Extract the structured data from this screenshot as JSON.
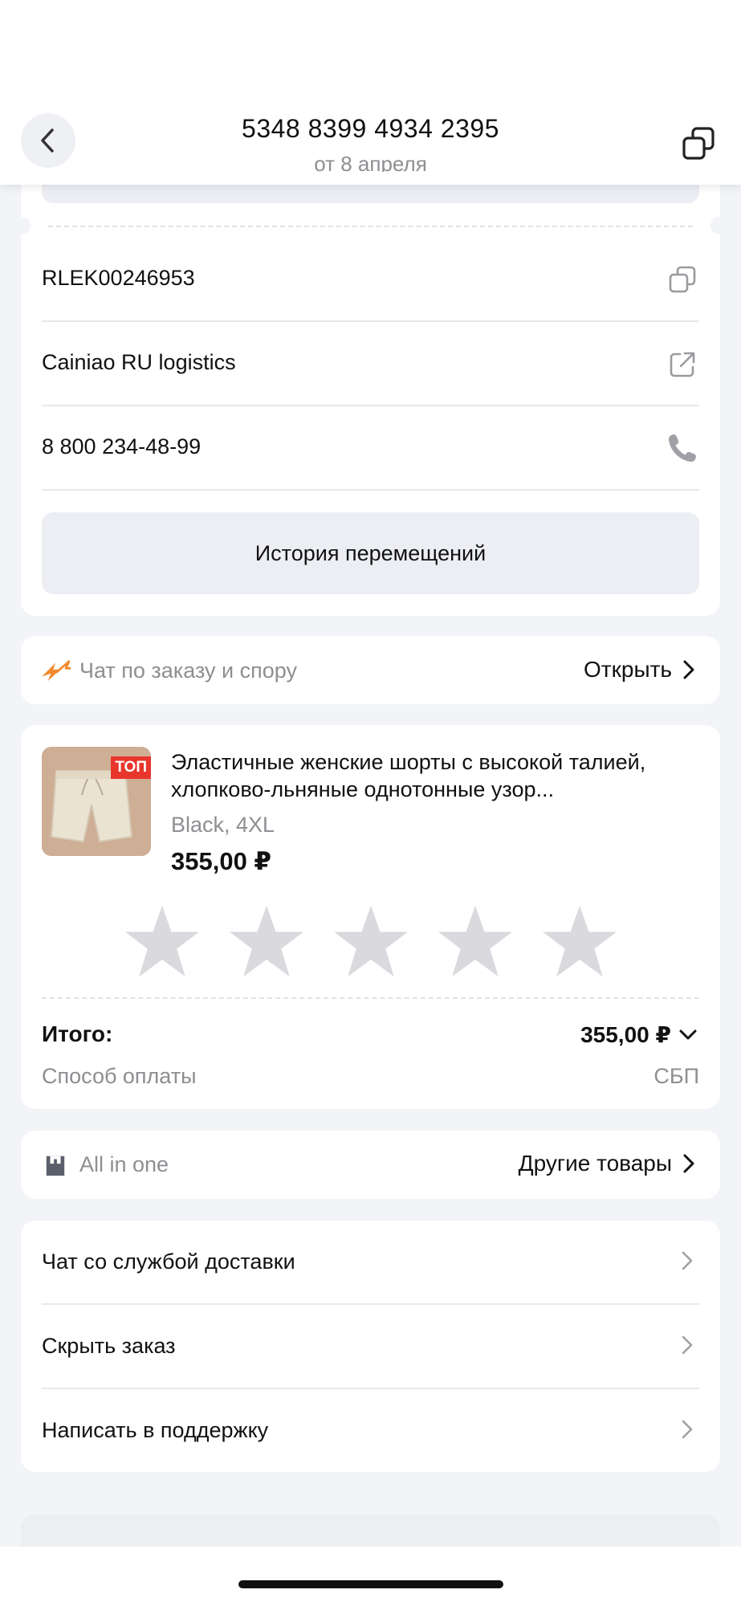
{
  "header": {
    "order_number": "5348 8399 4934 2395",
    "order_date": "от 8 апреля"
  },
  "tracking": {
    "track_number": "RLEK00246953",
    "carrier": "Cainiao RU logistics",
    "phone": "8 800 234-48-99",
    "history_button": "История перемещений"
  },
  "chat": {
    "label": "Чат по заказу и спору",
    "action": "Открыть"
  },
  "product": {
    "badge": "ТОП",
    "title": "Эластичные женские шорты с высокой талией, хлопково-льняные однотонные узор...",
    "variant": "Black, 4XL",
    "price": "355,00 ₽",
    "rating_stars": 5,
    "rating_value": 0
  },
  "summary": {
    "total_label": "Итого:",
    "total_value": "355,00 ₽",
    "payment_label": "Способ оплаты",
    "payment_value": "СБП"
  },
  "store": {
    "name": "All in one",
    "action": "Другие товары"
  },
  "actions": {
    "items": [
      {
        "label": "Чат со службой доставки"
      },
      {
        "label": "Скрыть заказ"
      },
      {
        "label": "Написать в поддержку"
      }
    ]
  },
  "colors": {
    "background": "#f2f4f7",
    "accent_orange": "#f08a2c",
    "badge_red": "#e8362c",
    "star_empty": "#d9d9de"
  }
}
